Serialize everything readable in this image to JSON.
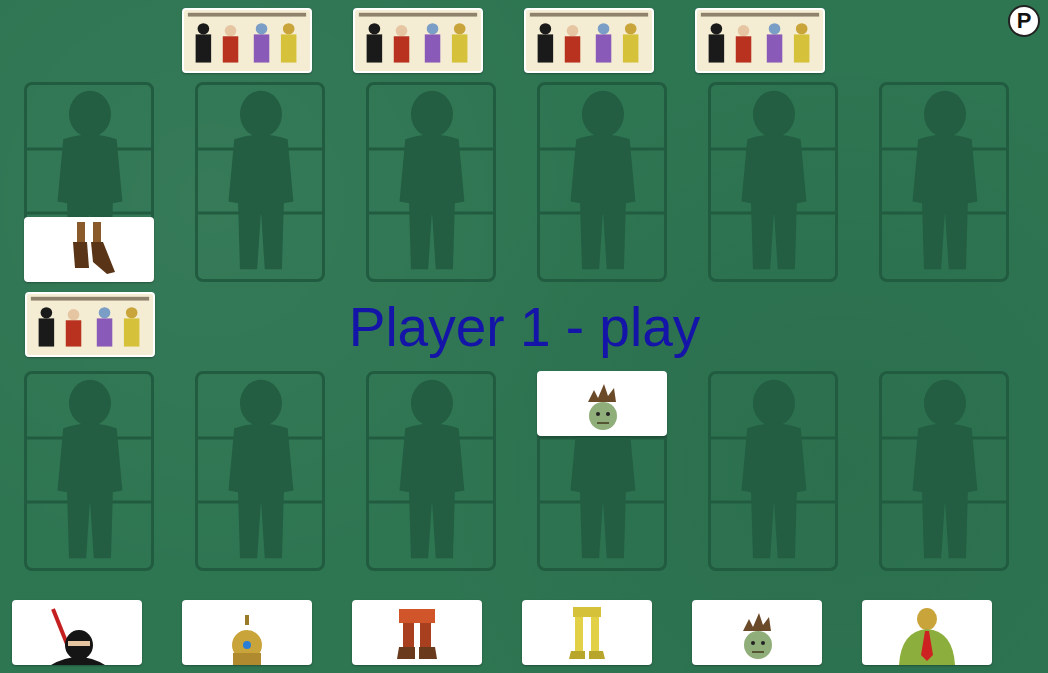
{
  "pause_button": {
    "label": "P"
  },
  "status": "Player 1 - play",
  "opponent_piles": [
    {
      "face_up": false
    },
    {
      "face_up": false
    },
    {
      "face_up": false
    },
    {
      "face_up": false
    }
  ],
  "draw_pile": {
    "face_up": false
  },
  "rows": [
    {
      "side": "top",
      "slots": [
        {
          "kind": "boots"
        },
        {
          "kind": "empty"
        },
        {
          "kind": "empty"
        },
        {
          "kind": "empty"
        },
        {
          "kind": "empty"
        },
        {
          "kind": "empty"
        }
      ]
    },
    {
      "side": "bottom",
      "slots": [
        {
          "kind": "empty"
        },
        {
          "kind": "empty"
        },
        {
          "kind": "empty"
        },
        {
          "kind": "zombie"
        },
        {
          "kind": "empty"
        },
        {
          "kind": "empty"
        }
      ]
    }
  ],
  "hand": [
    {
      "kind": "ninja"
    },
    {
      "kind": "robot"
    },
    {
      "kind": "pirate"
    },
    {
      "kind": "knight"
    },
    {
      "kind": "zombie"
    },
    {
      "kind": "brute"
    }
  ]
}
